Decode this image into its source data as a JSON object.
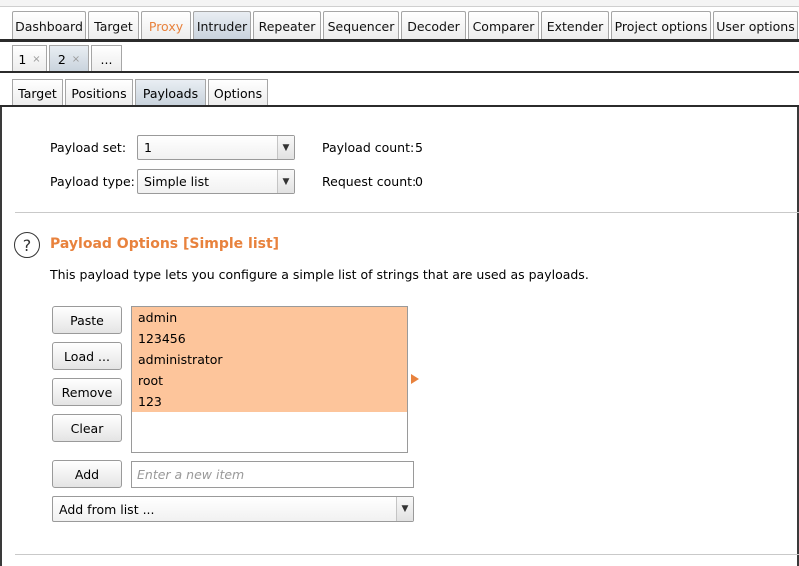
{
  "main_tabs": [
    {
      "label": "Dashboard",
      "active": false
    },
    {
      "label": "Target",
      "active": false
    },
    {
      "label": "Proxy",
      "active": false,
      "highlight": true
    },
    {
      "label": "Intruder",
      "active": true
    },
    {
      "label": "Repeater",
      "active": false
    },
    {
      "label": "Sequencer",
      "active": false
    },
    {
      "label": "Decoder",
      "active": false
    },
    {
      "label": "Comparer",
      "active": false
    },
    {
      "label": "Extender",
      "active": false
    },
    {
      "label": "Project options",
      "active": false
    },
    {
      "label": "User options",
      "active": false
    }
  ],
  "attack_tabs": [
    {
      "label": "1",
      "close": "×"
    },
    {
      "label": "2",
      "close": "×",
      "active": true
    },
    {
      "label": "..."
    }
  ],
  "sub_tabs": [
    {
      "label": "Target"
    },
    {
      "label": "Positions"
    },
    {
      "label": "Payloads",
      "active": true
    },
    {
      "label": "Options"
    }
  ],
  "payload_sets": {
    "set_label": "Payload set:",
    "set_value": "1",
    "type_label": "Payload type:",
    "type_value": "Simple list",
    "payload_count_label": "Payload count:",
    "payload_count": "5",
    "request_count_label": "Request count:",
    "request_count": "0"
  },
  "payload_options": {
    "title": "Payload Options [Simple list]",
    "description": "This payload type lets you configure a simple list of strings that are used as payloads.",
    "buttons": {
      "paste": "Paste",
      "load": "Load ...",
      "remove": "Remove",
      "clear": "Clear",
      "add": "Add"
    },
    "items": [
      "admin",
      "123456",
      "administrator",
      "root",
      "123"
    ],
    "new_item_placeholder": "Enter a new item",
    "add_from_list": "Add from list ..."
  },
  "icons": {
    "help": "question-circle-icon",
    "dropdown": "chevron-down-icon",
    "marker": "triangle-right-icon"
  },
  "colors": {
    "accent": "#e8823d",
    "selection": "#fdc59b"
  }
}
